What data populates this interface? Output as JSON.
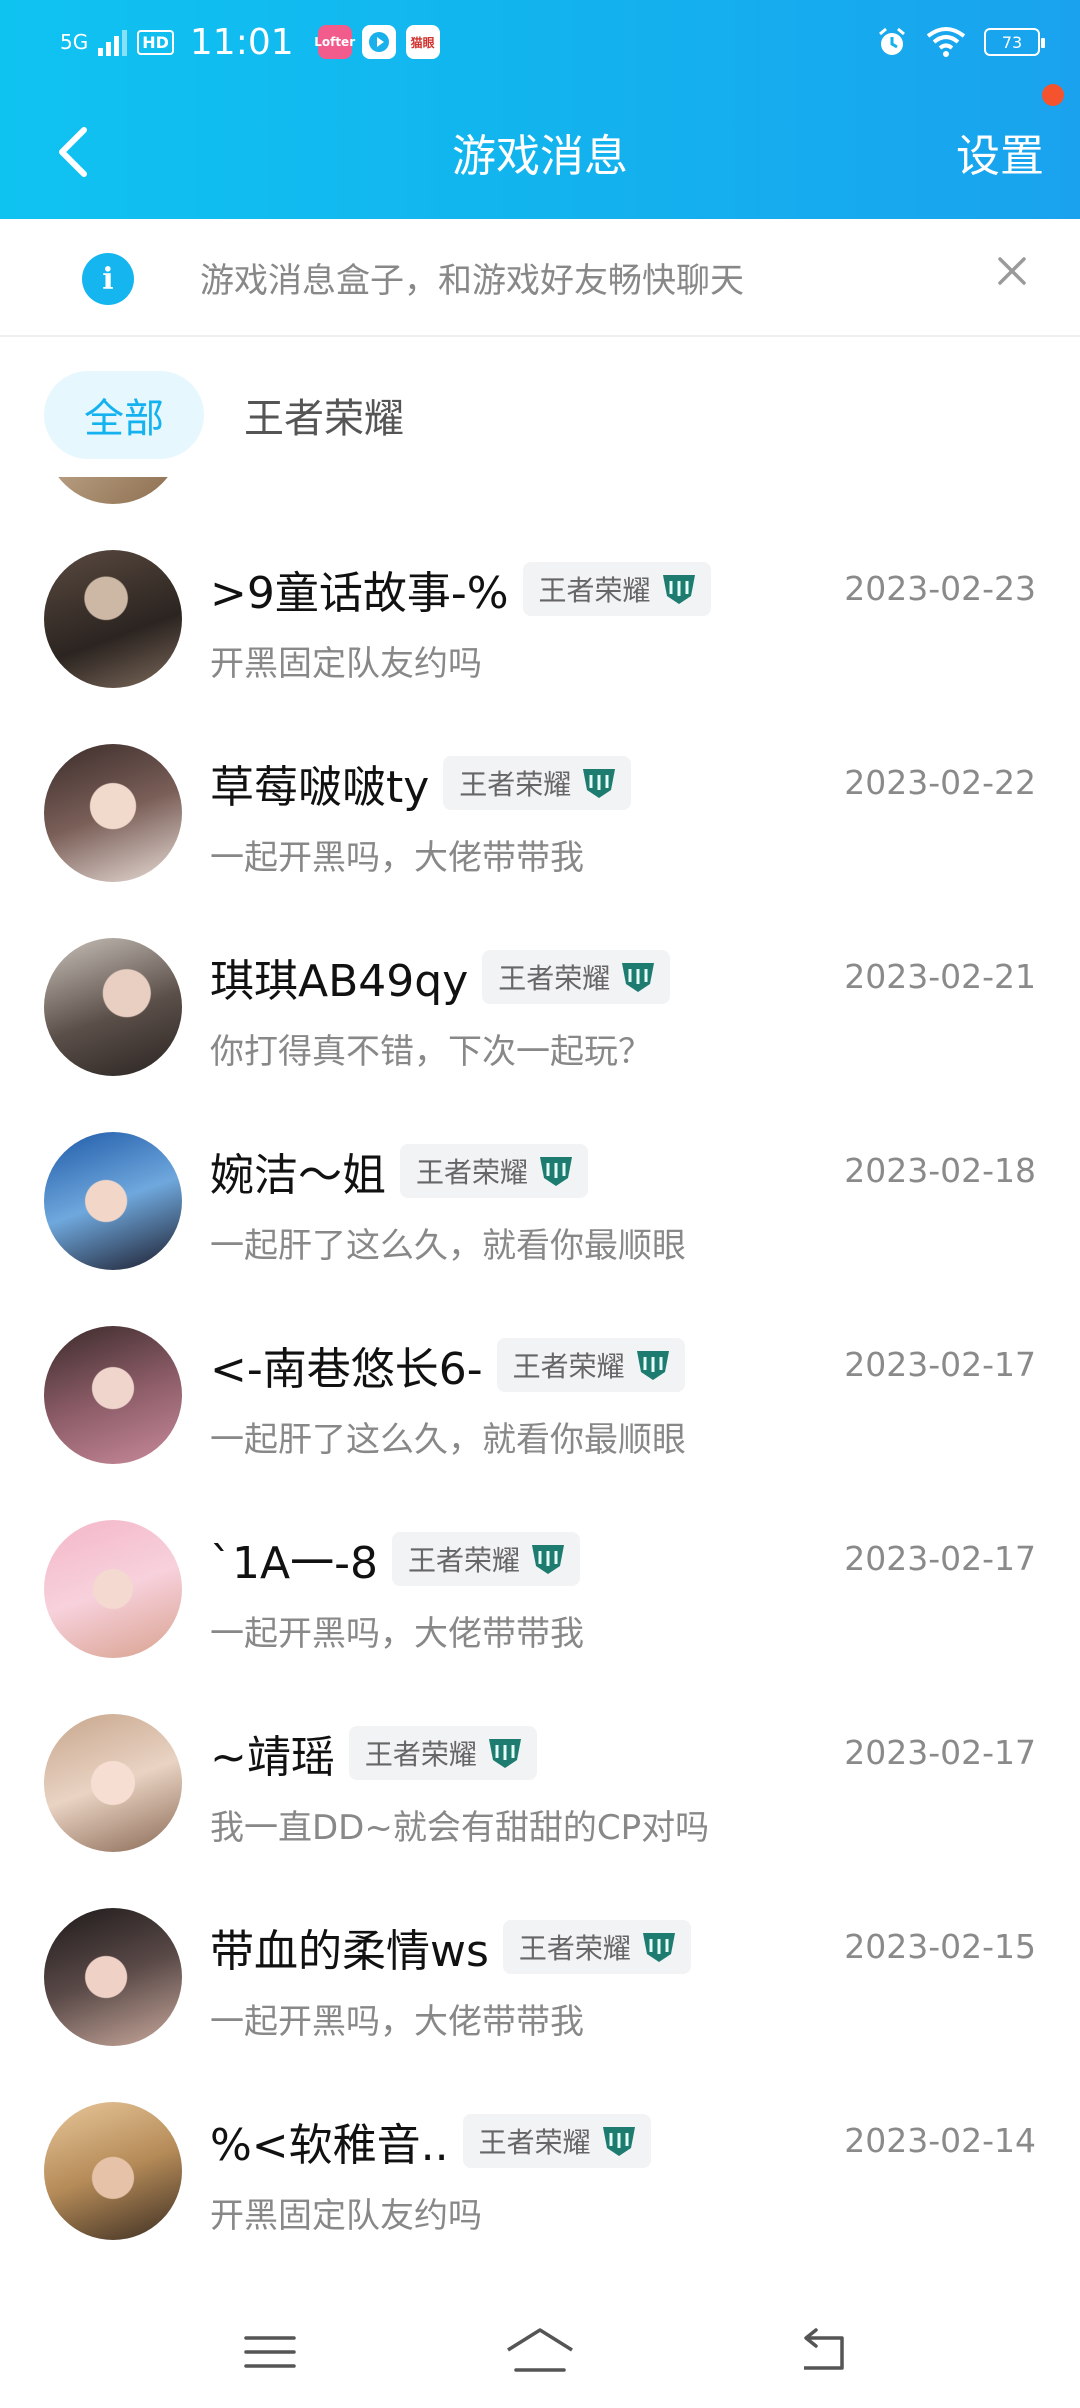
{
  "status_bar": {
    "network": "5G",
    "hd": "HD",
    "time": "11:01",
    "app_icon_1": "Lofter",
    "app_icon_3": "猫眼",
    "battery": "73",
    "icons": [
      "signal-icon",
      "alarm-icon",
      "wifi-icon",
      "battery-icon"
    ]
  },
  "header": {
    "title": "游戏消息",
    "settings_label": "设置",
    "back_icon": "chevron-left-icon",
    "accent_color": "#13b2ee",
    "dot_color": "#f5532d"
  },
  "notice": {
    "text": "游戏消息盒子，和游戏好友畅快聊天",
    "info_icon": "i"
  },
  "filters": {
    "all_label": "全部",
    "game_label": "王者荣耀"
  },
  "messages": [
    {
      "name": ">9童话故事-%",
      "tag": "王者荣耀",
      "date": "2023-02-23",
      "text": "开黑固定队友约吗"
    },
    {
      "name": "草莓啵啵ty",
      "tag": "王者荣耀",
      "date": "2023-02-22",
      "text": "一起开黑吗，大佬带带我"
    },
    {
      "name": "琪琪AB49qy",
      "tag": "王者荣耀",
      "date": "2023-02-21",
      "text": "你打得真不错，下次一起玩？"
    },
    {
      "name": "婉洁～姐",
      "tag": "王者荣耀",
      "date": "2023-02-18",
      "text": "一起肝了这么久，就看你最顺眼"
    },
    {
      "name": "<-南巷悠长6-",
      "tag": "王者荣耀",
      "date": "2023-02-17",
      "text": "一起肝了这么久，就看你最顺眼"
    },
    {
      "name": "`1A一-8",
      "tag": "王者荣耀",
      "date": "2023-02-17",
      "text": "一起开黑吗，大佬带带我"
    },
    {
      "name": "~靖瑶",
      "tag": "王者荣耀",
      "date": "2023-02-17",
      "text": "我一直DD~就会有甜甜的CP对吗"
    },
    {
      "name": "带血的柔情ws",
      "tag": "王者荣耀",
      "date": "2023-02-15",
      "text": "一起开黑吗，大佬带带我"
    },
    {
      "name": "%<软稚音..",
      "tag": "王者荣耀",
      "date": "2023-02-14",
      "text": "开黑固定队友约吗"
    }
  ],
  "bottom_nav": {
    "icons": [
      "menu-icon",
      "home-icon",
      "back-icon"
    ]
  }
}
